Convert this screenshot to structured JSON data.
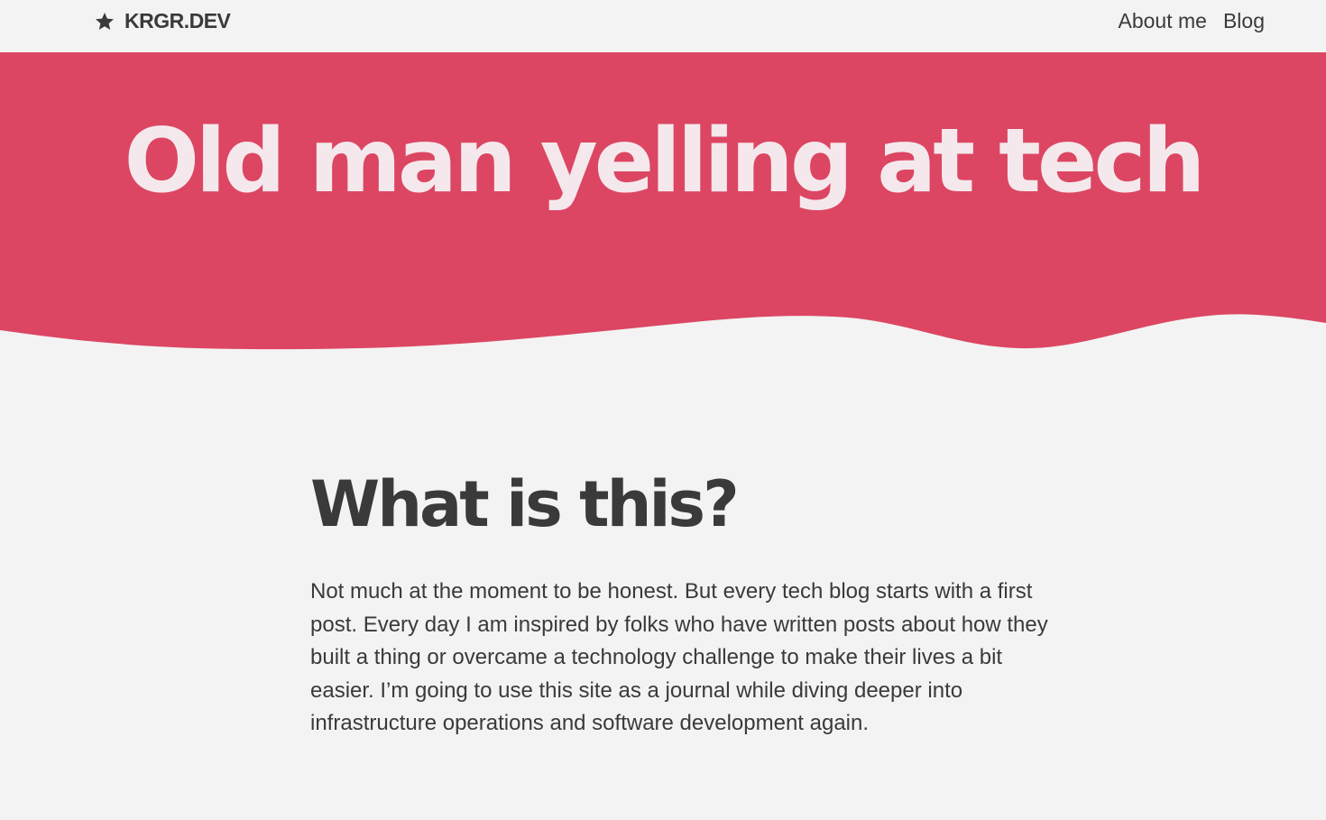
{
  "header": {
    "brand_label": "KRGR.DEV",
    "brand_icon": "star-icon",
    "nav": [
      {
        "label": "About me"
      },
      {
        "label": "Blog"
      }
    ]
  },
  "hero": {
    "title": "Old man yelling at tech"
  },
  "main": {
    "heading": "What is this?",
    "body": "Not much at the moment to be honest. But every tech blog starts with a first post. Every day I am inspired by folks who have written posts about how they built a thing or overcame a technology challenge to make their lives a bit easier. I’m going to use this site as a journal while diving deeper into infrastructure operations and software development again."
  },
  "colors": {
    "accent": "#dc4663",
    "background": "#f3f3f3",
    "text": "#3a3a3a",
    "hero_text": "#f5e8ec"
  }
}
